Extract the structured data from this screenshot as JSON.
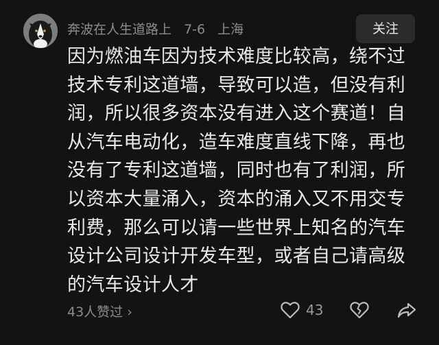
{
  "post": {
    "username": "奔波在人生道路上",
    "date": "7-6",
    "location": "上海",
    "follow_label": "关注",
    "avatar_icon": "dog-avatar",
    "content": "因为燃油车因为技术难度比较高，绕不过技术专利这道墙，导致可以造，但没有利润，所以很多资本没有进入这个赛道！自从汽车电动化，造车难度直线下降，再也没有了专利这道墙，同时也有了利润，所以资本大量涌入，资本的涌入又不用交专利费，那么可以请一些世界上知名的汽车设计公司设计开发车型，或者自己请高级的汽车设计人才"
  },
  "footer": {
    "liked_by_text": "43人赞过",
    "liked_by_chevron": "›",
    "like_count": "43",
    "like_icon": "heart-icon",
    "dislike_icon": "broken-heart-icon",
    "share_icon": "share-icon"
  }
}
